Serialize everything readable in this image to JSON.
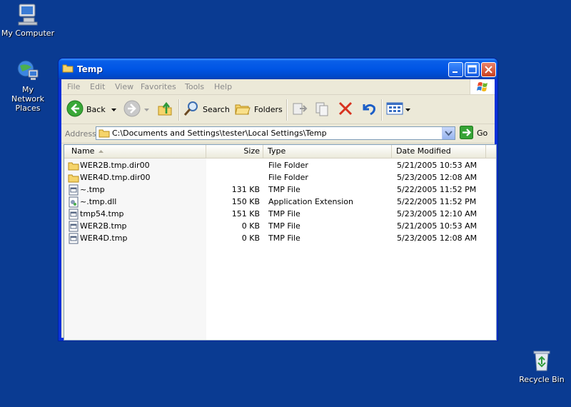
{
  "desktop": {
    "icons": [
      {
        "label": "My Computer",
        "icon": "my-computer-icon"
      },
      {
        "label": "My Network Places",
        "icon": "network-places-icon"
      },
      {
        "label": "Recycle Bin",
        "icon": "recycle-bin-icon"
      }
    ],
    "background_color": "#0a3b92"
  },
  "window": {
    "title": "Temp",
    "menu": [
      "File",
      "Edit",
      "View",
      "Favorites",
      "Tools",
      "Help"
    ],
    "toolbar": {
      "back_label": "Back",
      "search_label": "Search",
      "folders_label": "Folders"
    },
    "address": {
      "label": "Address",
      "value": "C:\\Documents and Settings\\tester\\Local Settings\\Temp",
      "go_label": "Go"
    },
    "columns": [
      "Name",
      "Size",
      "Type",
      "Date Modified"
    ],
    "files": [
      {
        "name": "WER2B.tmp.dir00",
        "size": "",
        "type": "File Folder",
        "date": "5/21/2005 10:53 AM",
        "icon": "folder-icon"
      },
      {
        "name": "WER4D.tmp.dir00",
        "size": "",
        "type": "File Folder",
        "date": "5/23/2005 12:08 AM",
        "icon": "folder-icon"
      },
      {
        "name": "~.tmp",
        "size": "131 KB",
        "type": "TMP File",
        "date": "5/22/2005 11:52 PM",
        "icon": "tmp-file-icon"
      },
      {
        "name": "~.tmp.dll",
        "size": "150 KB",
        "type": "Application Extension",
        "date": "5/22/2005 11:52 PM",
        "icon": "dll-file-icon"
      },
      {
        "name": "tmp54.tmp",
        "size": "151 KB",
        "type": "TMP File",
        "date": "5/23/2005 12:10 AM",
        "icon": "tmp-file-icon"
      },
      {
        "name": "WER2B.tmp",
        "size": "0 KB",
        "type": "TMP File",
        "date": "5/21/2005 10:53 AM",
        "icon": "tmp-file-icon"
      },
      {
        "name": "WER4D.tmp",
        "size": "0 KB",
        "type": "TMP File",
        "date": "5/23/2005 12:08 AM",
        "icon": "tmp-file-icon"
      }
    ]
  }
}
